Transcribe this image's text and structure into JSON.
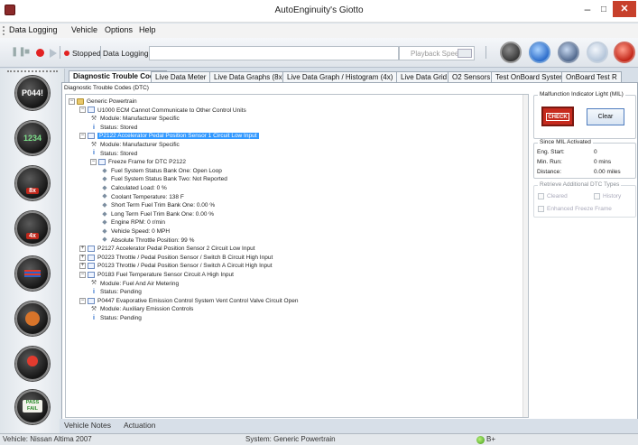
{
  "window": {
    "title": "AutoEnginuity's Giotto",
    "minimize_glyph": "–",
    "maximize_glyph": "□",
    "close_glyph": "✕"
  },
  "menu": {
    "items": [
      "Data Logging",
      "Vehicle",
      "Options",
      "Help"
    ]
  },
  "toolbar": {
    "status_label": "Stopped",
    "file_label": "Data Logging File",
    "file_value": "",
    "playback_label": "Playback Speed",
    "round_buttons": [
      "scantool-icon",
      "refresh-icon",
      "settings-dial-icon",
      "disabled-icon",
      "exit-icon"
    ]
  },
  "sidebar": {
    "buttons": [
      {
        "name": "p0441-dtc-button",
        "label": "P044!"
      },
      {
        "name": "live-meter-button",
        "label": "1234"
      },
      {
        "name": "graph-8x-button",
        "label": "8x"
      },
      {
        "name": "graph-4x-button",
        "label": "4x"
      },
      {
        "name": "data-grid-button",
        "label": ""
      },
      {
        "name": "sensors-button",
        "label": ""
      },
      {
        "name": "actuation-button",
        "label": ""
      },
      {
        "name": "pass-fail-button",
        "label": "PASS FAIL"
      }
    ]
  },
  "tabs": [
    {
      "label": "Diagnostic Trouble Codes",
      "active": true
    },
    {
      "label": "Live Data Meter",
      "active": false
    },
    {
      "label": "Live Data Graphs (8x)",
      "active": false
    },
    {
      "label": "Live Data Graph / Histogram (4x)",
      "active": false
    },
    {
      "label": "Live Data Grid",
      "active": false
    },
    {
      "label": "O2 Sensors",
      "active": false
    },
    {
      "label": "Test OnBoard System",
      "active": false
    },
    {
      "label": "OnBoard Test R",
      "active": false
    }
  ],
  "dtc": {
    "caption": "Diagnostic Trouble Codes (DTC)",
    "tree": [
      {
        "text": "Generic Powertrain",
        "icon": "folder"
      },
      {
        "text": "U1000    ECM Cannot Communicate to Other Control Units",
        "icon": "doc"
      },
      {
        "text": "Module: Manufacturer Specific",
        "icon": "tools"
      },
      {
        "text": "Status: Stored",
        "icon": "info"
      },
      {
        "text": "P2122    Accelerator Pedal Position Sensor 1 Circuit Low Input",
        "icon": "doc",
        "selected": true
      },
      {
        "text": "Module: Manufacturer Specific",
        "icon": "tools"
      },
      {
        "text": "Status: Stored",
        "icon": "info"
      },
      {
        "text": "Freeze Frame for DTC P2122",
        "icon": "doc"
      },
      {
        "text": "Fuel System Status Bank One: Open Loop",
        "icon": "gem"
      },
      {
        "text": "Fuel System Status Bank Two: Not Reported",
        "icon": "gem"
      },
      {
        "text": "Calculated Load: 0 %",
        "icon": "gem"
      },
      {
        "text": "Coolant Temperature: 138 F",
        "icon": "gem"
      },
      {
        "text": "Short Term Fuel Trim Bank One: 0.00 %",
        "icon": "gem"
      },
      {
        "text": "Long Term Fuel Trim Bank One: 0.00 %",
        "icon": "gem"
      },
      {
        "text": "Engine RPM: 0 r/min",
        "icon": "gem"
      },
      {
        "text": "Vehicle Speed: 0 MPH",
        "icon": "gem"
      },
      {
        "text": "Absolute Throttle Position: 99 %",
        "icon": "gem"
      },
      {
        "text": "P2127    Accelerator Pedal Position Sensor 2 Circuit Low Input",
        "icon": "doc"
      },
      {
        "text": "P0223    Throttle / Pedal Position Sensor / Switch B Circuit High Input",
        "icon": "doc"
      },
      {
        "text": "P0123    Throttle / Pedal Position Sensor / Switch A Circuit High Input",
        "icon": "doc"
      },
      {
        "text": "P0183    Fuel Temperature Sensor Circuit A High Input",
        "icon": "doc"
      },
      {
        "text": "Module: Fuel And Air Metering",
        "icon": "tools"
      },
      {
        "text": "Status: Pending",
        "icon": "info"
      },
      {
        "text": "P0447    Evaporative Emission Control System Vent Control Valve Circuit Open",
        "icon": "doc"
      },
      {
        "text": "Module: Auxiliary Emission Controls",
        "icon": "tools"
      },
      {
        "text": "Status: Pending",
        "icon": "info"
      }
    ]
  },
  "mil": {
    "group_title": "Malfunction Indicator Light (MIL)",
    "check_label": "CHECK",
    "clear_label": "Clear",
    "since_title": "Since MIL Activated",
    "rows": [
      {
        "label": "Eng. Start:",
        "value": "0"
      },
      {
        "label": "Min. Run:",
        "value": "0 mins"
      },
      {
        "label": "Distance:",
        "value": "0.00 miles"
      }
    ],
    "retrieve_title": "Retrieve Additional DTC Types",
    "cleared_label": "Cleared",
    "history_label": "History",
    "enhanced_label": "Enhanced Freeze Frame"
  },
  "bottom_tabs": [
    "Vehicle Notes",
    "Actuation"
  ],
  "status": {
    "vehicle": "Vehicle: Nissan  Altima  2007",
    "system": "System: Generic Powertrain",
    "battery": "B+"
  }
}
